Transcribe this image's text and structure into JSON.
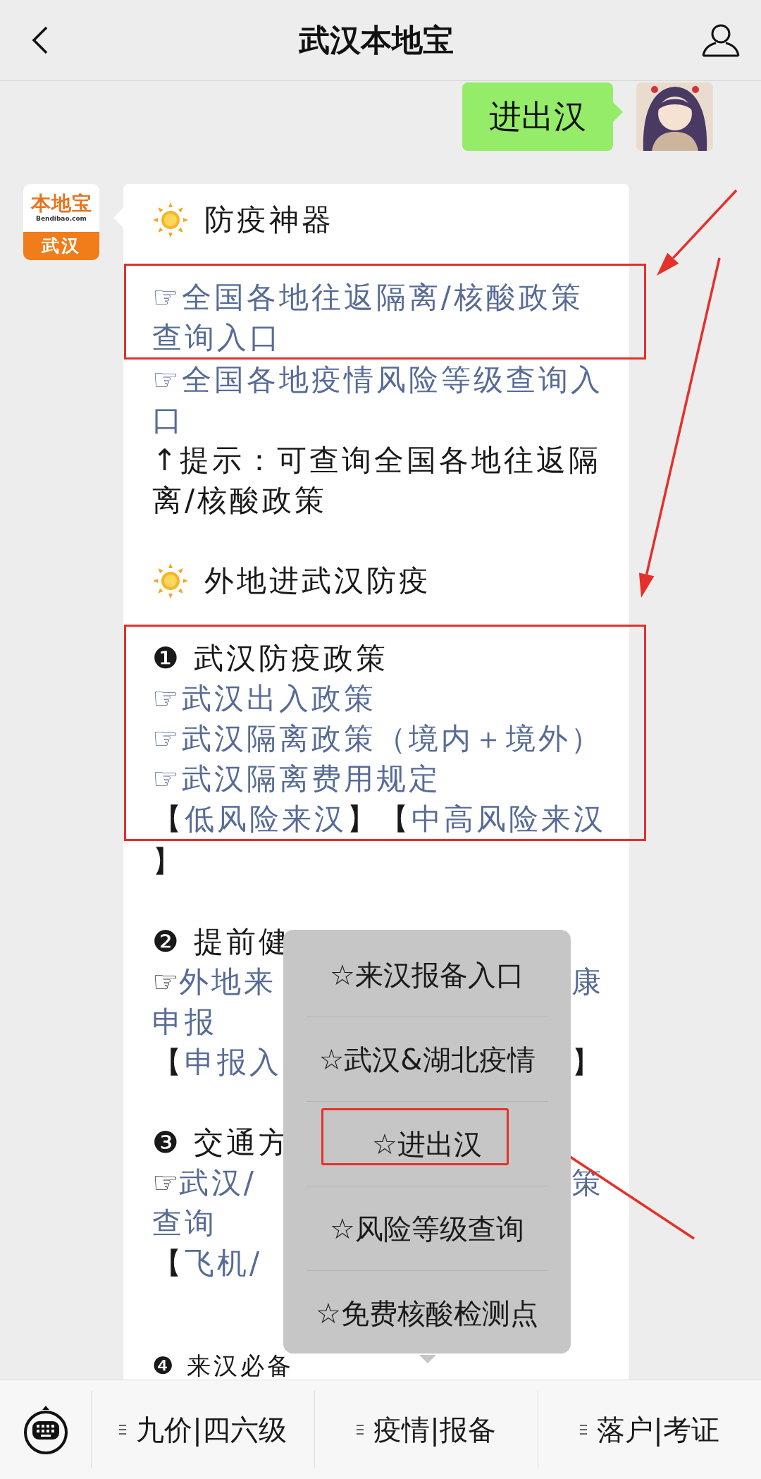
{
  "header": {
    "title": "武汉本地宝"
  },
  "messages": [
    {
      "kind": "user",
      "text": "进出汉"
    },
    {
      "kind": "bot",
      "logo": {
        "brand": "本地宝",
        "site": "Bendibao.com",
        "city": "武汉"
      },
      "lines": [
        {
          "kind": "heading",
          "text": "防疫神器"
        },
        {
          "kind": "group",
          "highlight": true,
          "lines": [
            {
              "parts": [
                {
                  "kind": "pointer",
                  "text": "☞"
                },
                {
                  "kind": "link",
                  "text": "全国各地往返隔离/核酸政策查询入口"
                }
              ]
            }
          ]
        },
        {
          "kind": "line",
          "parts": [
            {
              "kind": "pointer",
              "text": "☞"
            },
            {
              "kind": "link",
              "text": "全国各地疫情风险等级查询入口"
            }
          ]
        },
        {
          "kind": "line",
          "parts": [
            {
              "kind": "plain",
              "text": "↑提示：可查询全国各地往返隔离/核酸政策"
            }
          ]
        },
        {
          "kind": "blank"
        },
        {
          "kind": "heading",
          "text": "外地进武汉防疫"
        },
        {
          "kind": "group",
          "highlight": true,
          "lines": [
            {
              "parts": [
                {
                  "kind": "plain",
                  "text": "❶ 武汉防疫政策"
                }
              ]
            },
            {
              "parts": [
                {
                  "kind": "pointer",
                  "text": "☞"
                },
                {
                  "kind": "link",
                  "text": "武汉出入政策"
                }
              ]
            },
            {
              "parts": [
                {
                  "kind": "pointer",
                  "text": "☞"
                },
                {
                  "kind": "link",
                  "text": "武汉隔离政策（境内＋境外）"
                }
              ]
            },
            {
              "parts": [
                {
                  "kind": "pointer",
                  "text": "☞"
                },
                {
                  "kind": "link",
                  "text": "武汉隔离费用规定"
                }
              ]
            },
            {
              "parts": [
                {
                  "kind": "plain",
                  "text": "【"
                },
                {
                  "kind": "link",
                  "text": "低风险来汉"
                },
                {
                  "kind": "plain",
                  "text": "】"
                },
                {
                  "kind": "plain",
                  "text": "【"
                },
                {
                  "kind": "link",
                  "text": "中高风险来汉"
                }
              ]
            }
          ]
        },
        {
          "kind": "line",
          "parts": [
            {
              "kind": "plain",
              "text": "】"
            }
          ]
        },
        {
          "kind": "blank"
        },
        {
          "kind": "line",
          "parts": [
            {
              "kind": "plain",
              "text": "❷ 提前健"
            }
          ]
        },
        {
          "kind": "line",
          "parts": [
            {
              "kind": "pointer",
              "text": "☞"
            },
            {
              "kind": "link",
              "text": "外地来"
            }
          ],
          "right": [
            {
              "kind": "link",
              "text": "康"
            }
          ]
        },
        {
          "kind": "line",
          "parts": [
            {
              "kind": "link",
              "text": "申报"
            }
          ]
        },
        {
          "kind": "line",
          "parts": [
            {
              "kind": "plain",
              "text": "【"
            },
            {
              "kind": "link",
              "text": "申报入"
            }
          ],
          "right": [
            {
              "kind": "plain",
              "text": "】"
            }
          ]
        },
        {
          "kind": "blank"
        },
        {
          "kind": "line",
          "parts": [
            {
              "kind": "plain",
              "text": "❸ 交通方"
            }
          ]
        },
        {
          "kind": "line",
          "parts": [
            {
              "kind": "pointer",
              "text": "☞"
            },
            {
              "kind": "link",
              "text": "武汉/"
            }
          ],
          "right": [
            {
              "kind": "link",
              "text": "策"
            }
          ]
        },
        {
          "kind": "line",
          "parts": [
            {
              "kind": "link",
              "text": "查询"
            }
          ]
        },
        {
          "kind": "line",
          "parts": [
            {
              "kind": "plain",
              "text": "【"
            },
            {
              "kind": "link",
              "text": "飞机/"
            }
          ]
        },
        {
          "kind": "blank"
        },
        {
          "kind": "line",
          "parts": [
            {
              "kind": "plain",
              "text": "❹ 来汉必备"
            }
          ]
        }
      ]
    }
  ],
  "popup_menu": {
    "items": [
      {
        "label": "☆来汉报备入口",
        "highlight": false
      },
      {
        "label": "☆武汉&湖北疫情",
        "highlight": false
      },
      {
        "label": "☆进出汉",
        "highlight": true
      },
      {
        "label": "☆风险等级查询",
        "highlight": false
      },
      {
        "label": "☆免费核酸检测点",
        "highlight": false
      }
    ]
  },
  "bottom_menu": {
    "items": [
      {
        "label": "九价|四六级"
      },
      {
        "label": "疫情|报备"
      },
      {
        "label": "落户|考证"
      }
    ]
  }
}
